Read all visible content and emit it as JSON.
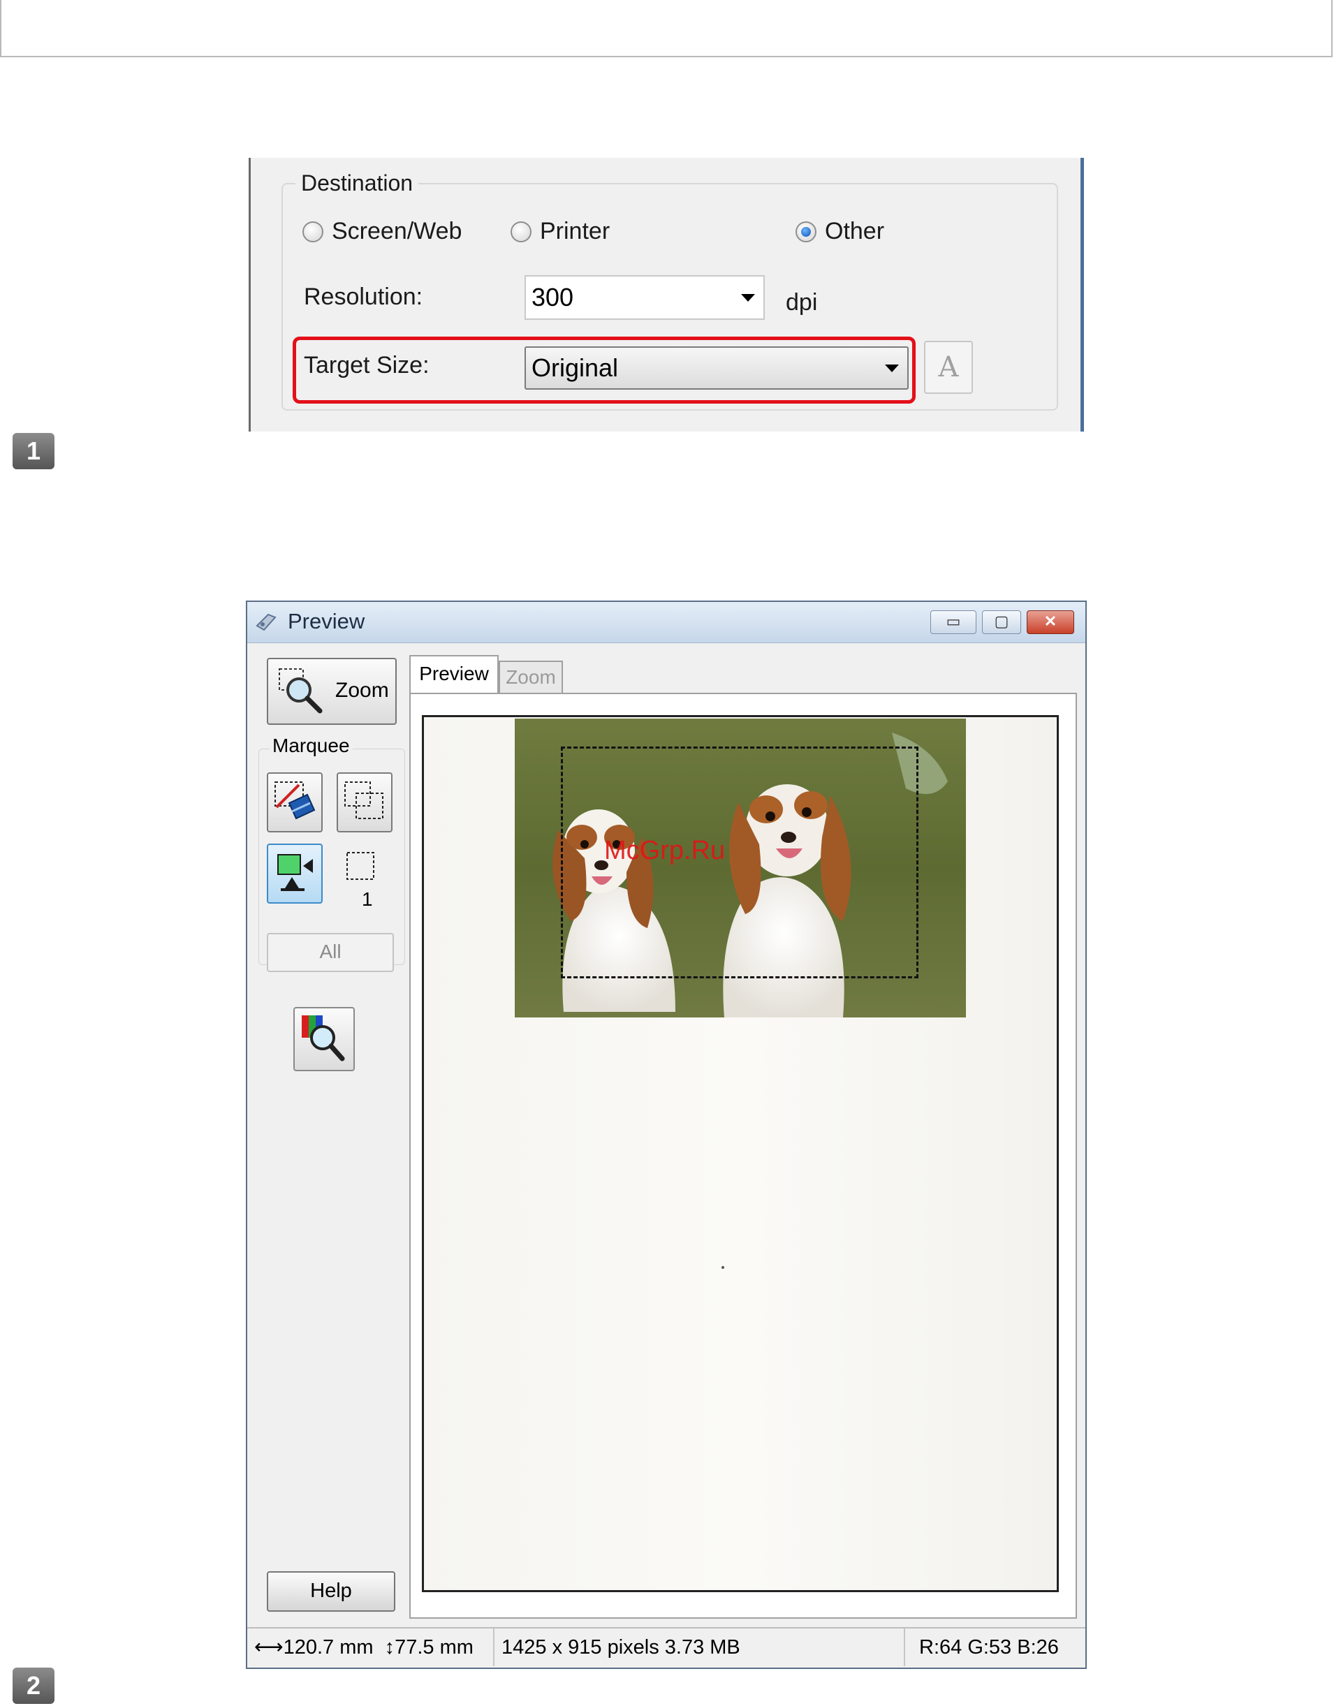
{
  "destination": {
    "legend": "Destination",
    "options": [
      {
        "label": "Screen/Web",
        "selected": false
      },
      {
        "label": "Printer",
        "selected": false
      },
      {
        "label": "Other",
        "selected": true
      }
    ],
    "resolution_label": "Resolution:",
    "resolution_value": "300",
    "resolution_unit": "dpi",
    "target_size_label": "Target Size:",
    "target_size_value": "Original",
    "font_button_glyph": "A"
  },
  "badges": {
    "step1": "1",
    "step2": "2"
  },
  "preview_window": {
    "title": "Preview",
    "controls": {
      "minimize": "▭",
      "maximize": "▢",
      "close": "✕"
    },
    "zoom_button": "Zoom",
    "marquee_label": "Marquee",
    "marquee_count": "1",
    "all_button": "All",
    "help_button": "Help",
    "tabs": [
      {
        "label": "Preview",
        "active": true
      },
      {
        "label": "Zoom",
        "active": false
      }
    ],
    "status": {
      "width": "120.7 mm",
      "height": "77.5 mm",
      "size": "1425 x 915 pixels 3.73 MB",
      "rgb": "R:64 G:53 B:26"
    },
    "watermark": "McGrp.Ru"
  },
  "colors": {
    "highlight": "#e3101a",
    "accent": "#3c8ac8"
  }
}
